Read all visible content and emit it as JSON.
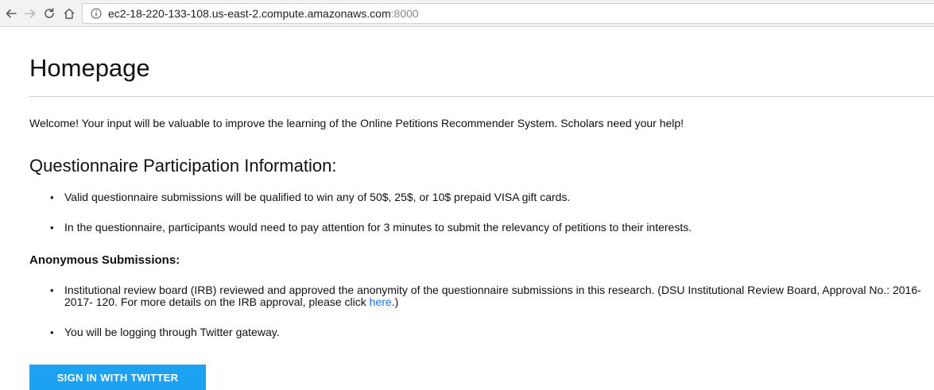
{
  "browser": {
    "url_host": "ec2-18-220-133-108.us-east-2.compute.amazonaws.com",
    "url_port": ":8000",
    "icons": [
      "back-arrow-icon",
      "forward-arrow-icon",
      "reload-icon",
      "home-icon",
      "info-icon"
    ]
  },
  "page": {
    "title": "Homepage",
    "welcome": "Welcome! Your input will be valuable to improve the learning of the Online Petitions Recommender System. Scholars need your help!",
    "participation": {
      "heading": "Questionnaire Participation Information:",
      "items": [
        "Valid questionnaire submissions will be qualified to win any of 50$, 25$, or 10$ prepaid VISA gift cards.",
        "In the questionnaire, participants would need to pay attention for 3 minutes to submit the relevancy of petitions to their interests."
      ]
    },
    "anonymous": {
      "heading": "Anonymous Submissions:",
      "irb_text_before": "Institutional review board (IRB) reviewed and approved the anonymity of the questionnaire submissions in this research. (DSU Institutional Review Board, Approval No.: 2016-2017- 120. For more details on the IRB approval, please click ",
      "irb_link": "here",
      "irb_text_after": ".)",
      "gateway_text": "You will be logging through Twitter gateway."
    },
    "signin_button": "SIGN IN WITH TWITTER"
  },
  "colors": {
    "link": "#1a73e8",
    "twitter_button": "#1da1f2"
  }
}
